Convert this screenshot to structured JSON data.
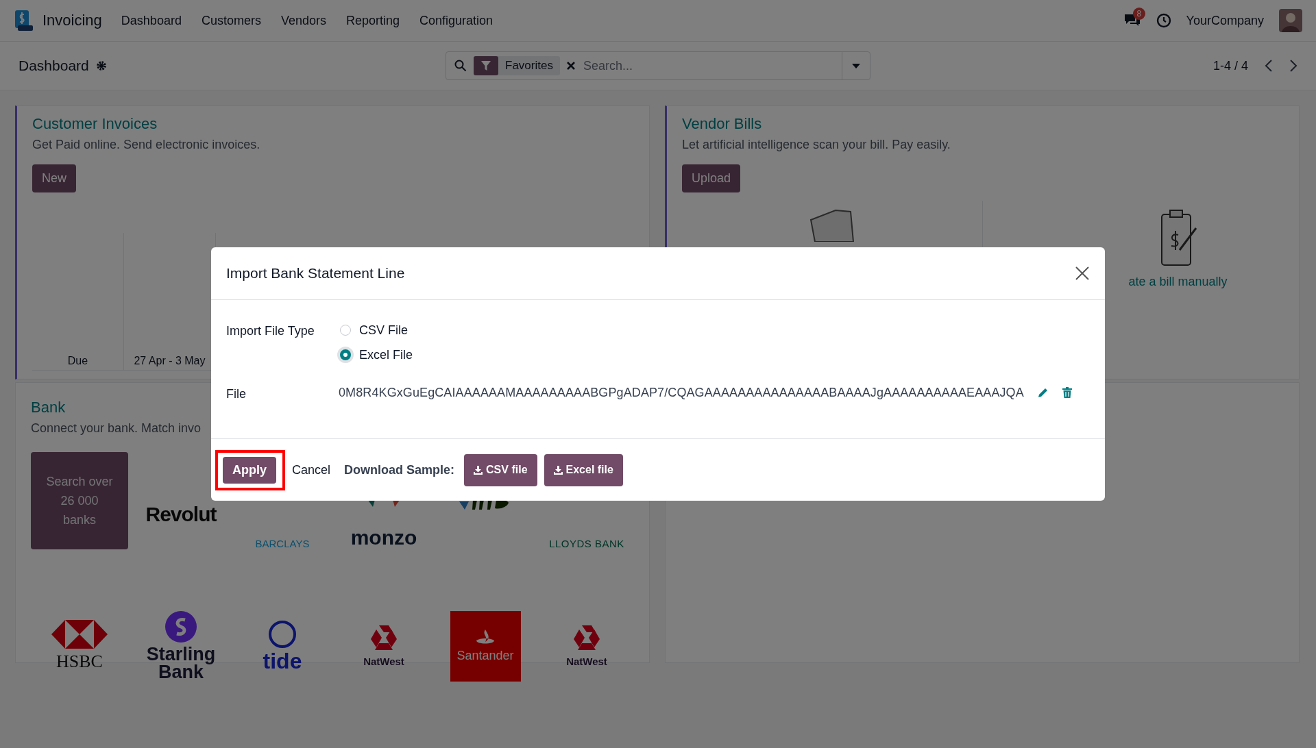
{
  "navbar": {
    "app_name": "Invoicing",
    "menu": [
      "Dashboard",
      "Customers",
      "Vendors",
      "Reporting",
      "Configuration"
    ],
    "message_count": "8",
    "company": "YourCompany"
  },
  "control_panel": {
    "title": "Dashboard",
    "facet": "Favorites",
    "search_placeholder": "Search...",
    "pager": "1-4 / 4"
  },
  "customer_invoices": {
    "title": "Customer Invoices",
    "subtitle": "Get Paid online. Send electronic invoices.",
    "button": "New",
    "chart_labels": [
      "Due",
      "27 Apr - 3 May"
    ]
  },
  "vendor_bills": {
    "title": "Vendor Bills",
    "subtitle": "Let artificial intelligence scan your bill. Pay easily.",
    "button": "Upload",
    "manual_link": "ate a bill manually"
  },
  "bank": {
    "title": "Bank",
    "subtitle": "Connect your bank. Match invo",
    "search_tile": "Search over 26 000 banks",
    "logos": [
      {
        "kind": "revolut",
        "text": "Revolut"
      },
      {
        "kind": "barclays",
        "text": "BARCLAYS"
      },
      {
        "kind": "monzo",
        "text": "monzo"
      },
      {
        "kind": "wise"
      },
      {
        "kind": "lloyds",
        "text": "LLOYDS BANK"
      },
      {
        "kind": "hsbc",
        "text": "HSBC"
      },
      {
        "kind": "starling",
        "text": "Starling Bank"
      },
      {
        "kind": "tide",
        "text": "tide"
      },
      {
        "kind": "natwest",
        "text": "NatWest"
      },
      {
        "kind": "santander",
        "text": "Santander"
      },
      {
        "kind": "natwest",
        "text": "NatWest"
      }
    ]
  },
  "dialog": {
    "title": "Import Bank Statement Line",
    "fields": [
      {
        "kind": "radio",
        "label": "Import File Type",
        "options": [
          {
            "label": "CSV File",
            "selected": false
          },
          {
            "label": "Excel File",
            "selected": true
          }
        ]
      },
      {
        "kind": "file",
        "label": "File",
        "value": "0M8R4KGxGuEgCAIAAAAAAMAAAAAAAAABGPgADAP7/CQAGAAAAAAAAAAAAAAABAAAAJgAAAAAAAAAAEAAAJQA"
      }
    ],
    "buttons": [
      {
        "kind": "primary",
        "label": "Apply",
        "highlighted": true
      },
      {
        "kind": "link",
        "label": "Cancel",
        "highlighted": false
      }
    ],
    "sample_label": "Download Sample:",
    "sample_buttons": [
      "CSV file",
      "Excel file"
    ]
  }
}
